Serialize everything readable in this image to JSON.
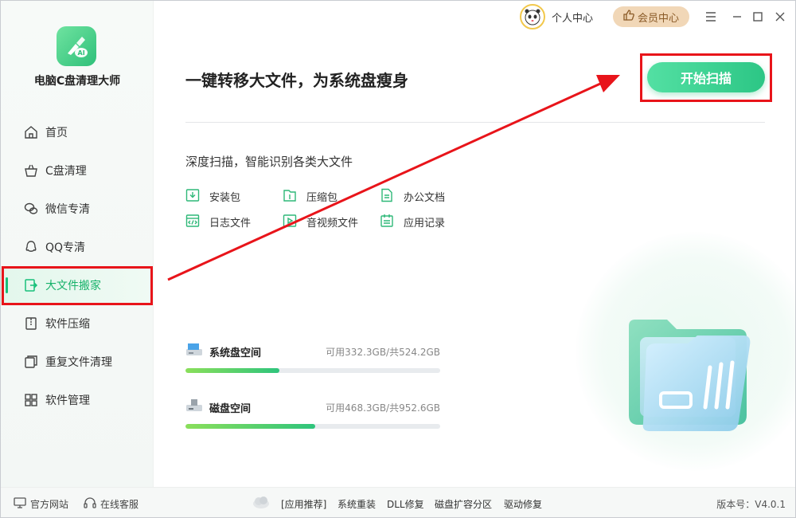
{
  "app": {
    "title": "电脑C盘清理大师"
  },
  "topbar": {
    "personal_center": "个人中心",
    "vip_center": "会员中心"
  },
  "sidebar": {
    "items": [
      {
        "label": "首页",
        "icon": "home-icon"
      },
      {
        "label": "C盘清理",
        "icon": "basket-icon"
      },
      {
        "label": "微信专清",
        "icon": "wechat-icon"
      },
      {
        "label": "QQ专清",
        "icon": "qq-icon"
      },
      {
        "label": "大文件搬家",
        "icon": "file-move-icon",
        "active": true
      },
      {
        "label": "软件压缩",
        "icon": "zip-icon"
      },
      {
        "label": "重复文件清理",
        "icon": "duplicate-icon"
      },
      {
        "label": "软件管理",
        "icon": "apps-icon"
      }
    ]
  },
  "main": {
    "headline": "一键转移大文件，为系统盘瘦身",
    "scan_button": "开始扫描",
    "subhead": "深度扫描，智能识别各类大文件",
    "types": [
      "安装包",
      "压缩包",
      "办公文档",
      "日志文件",
      "音视频文件",
      "应用记录"
    ],
    "disks": [
      {
        "name": "系统盘空间",
        "capacity": "可用332.3GB/共524.2GB",
        "used_fraction": 0.37
      },
      {
        "name": "磁盘空间",
        "capacity": "可用468.3GB/共952.6GB",
        "used_fraction": 0.51
      }
    ]
  },
  "footer": {
    "official_site": "官方网站",
    "online_service": "在线客服",
    "recommend": "[应用推荐]",
    "links": [
      "系统重装",
      "DLL修复",
      "磁盘扩容分区",
      "驱动修复"
    ],
    "version": "版本号：V4.0.1"
  },
  "colors": {
    "accent": "#18c07a",
    "annotation_red": "#e8141a",
    "vip": "#f1d7b7"
  }
}
